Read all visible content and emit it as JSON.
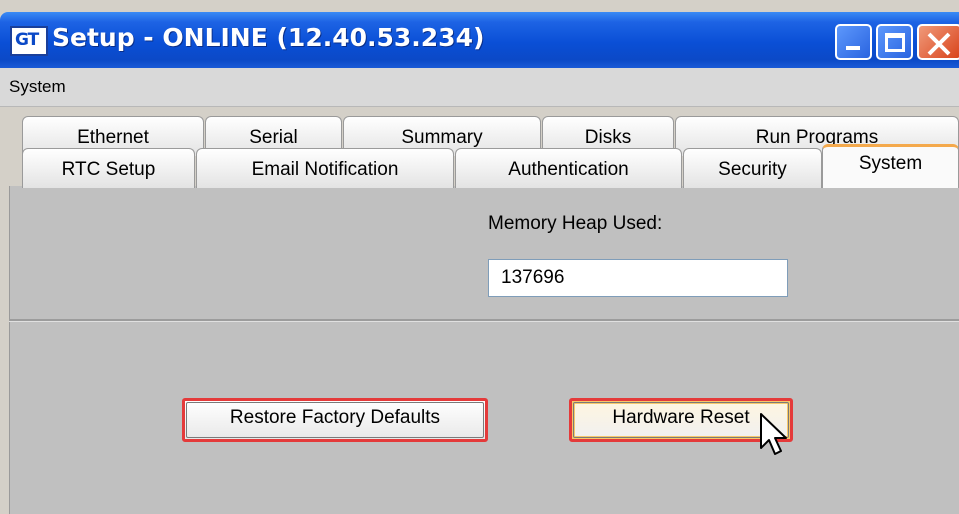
{
  "window": {
    "title": "Setup - ONLINE (12.40.53.234)",
    "app_icon_text": "GT"
  },
  "menu": {
    "items": [
      "System"
    ]
  },
  "tabs": {
    "row1": [
      "Ethernet",
      "Serial",
      "Summary",
      "Disks",
      "Run Programs"
    ],
    "row2": [
      "RTC Setup",
      "Email Notification",
      "Authentication",
      "Security",
      "System"
    ],
    "active": "System"
  },
  "system_panel": {
    "memory_heap_label": "Memory Heap Used:",
    "memory_heap_value": "137696",
    "restore_button": "Restore Factory Defaults",
    "reset_button": "Hardware Reset"
  },
  "colors": {
    "titlebar": "#0b49c7",
    "active_tab_accent": "#f4a94c",
    "button_highlight": "#e43a3a",
    "panel_bg": "#c0c0c0"
  }
}
